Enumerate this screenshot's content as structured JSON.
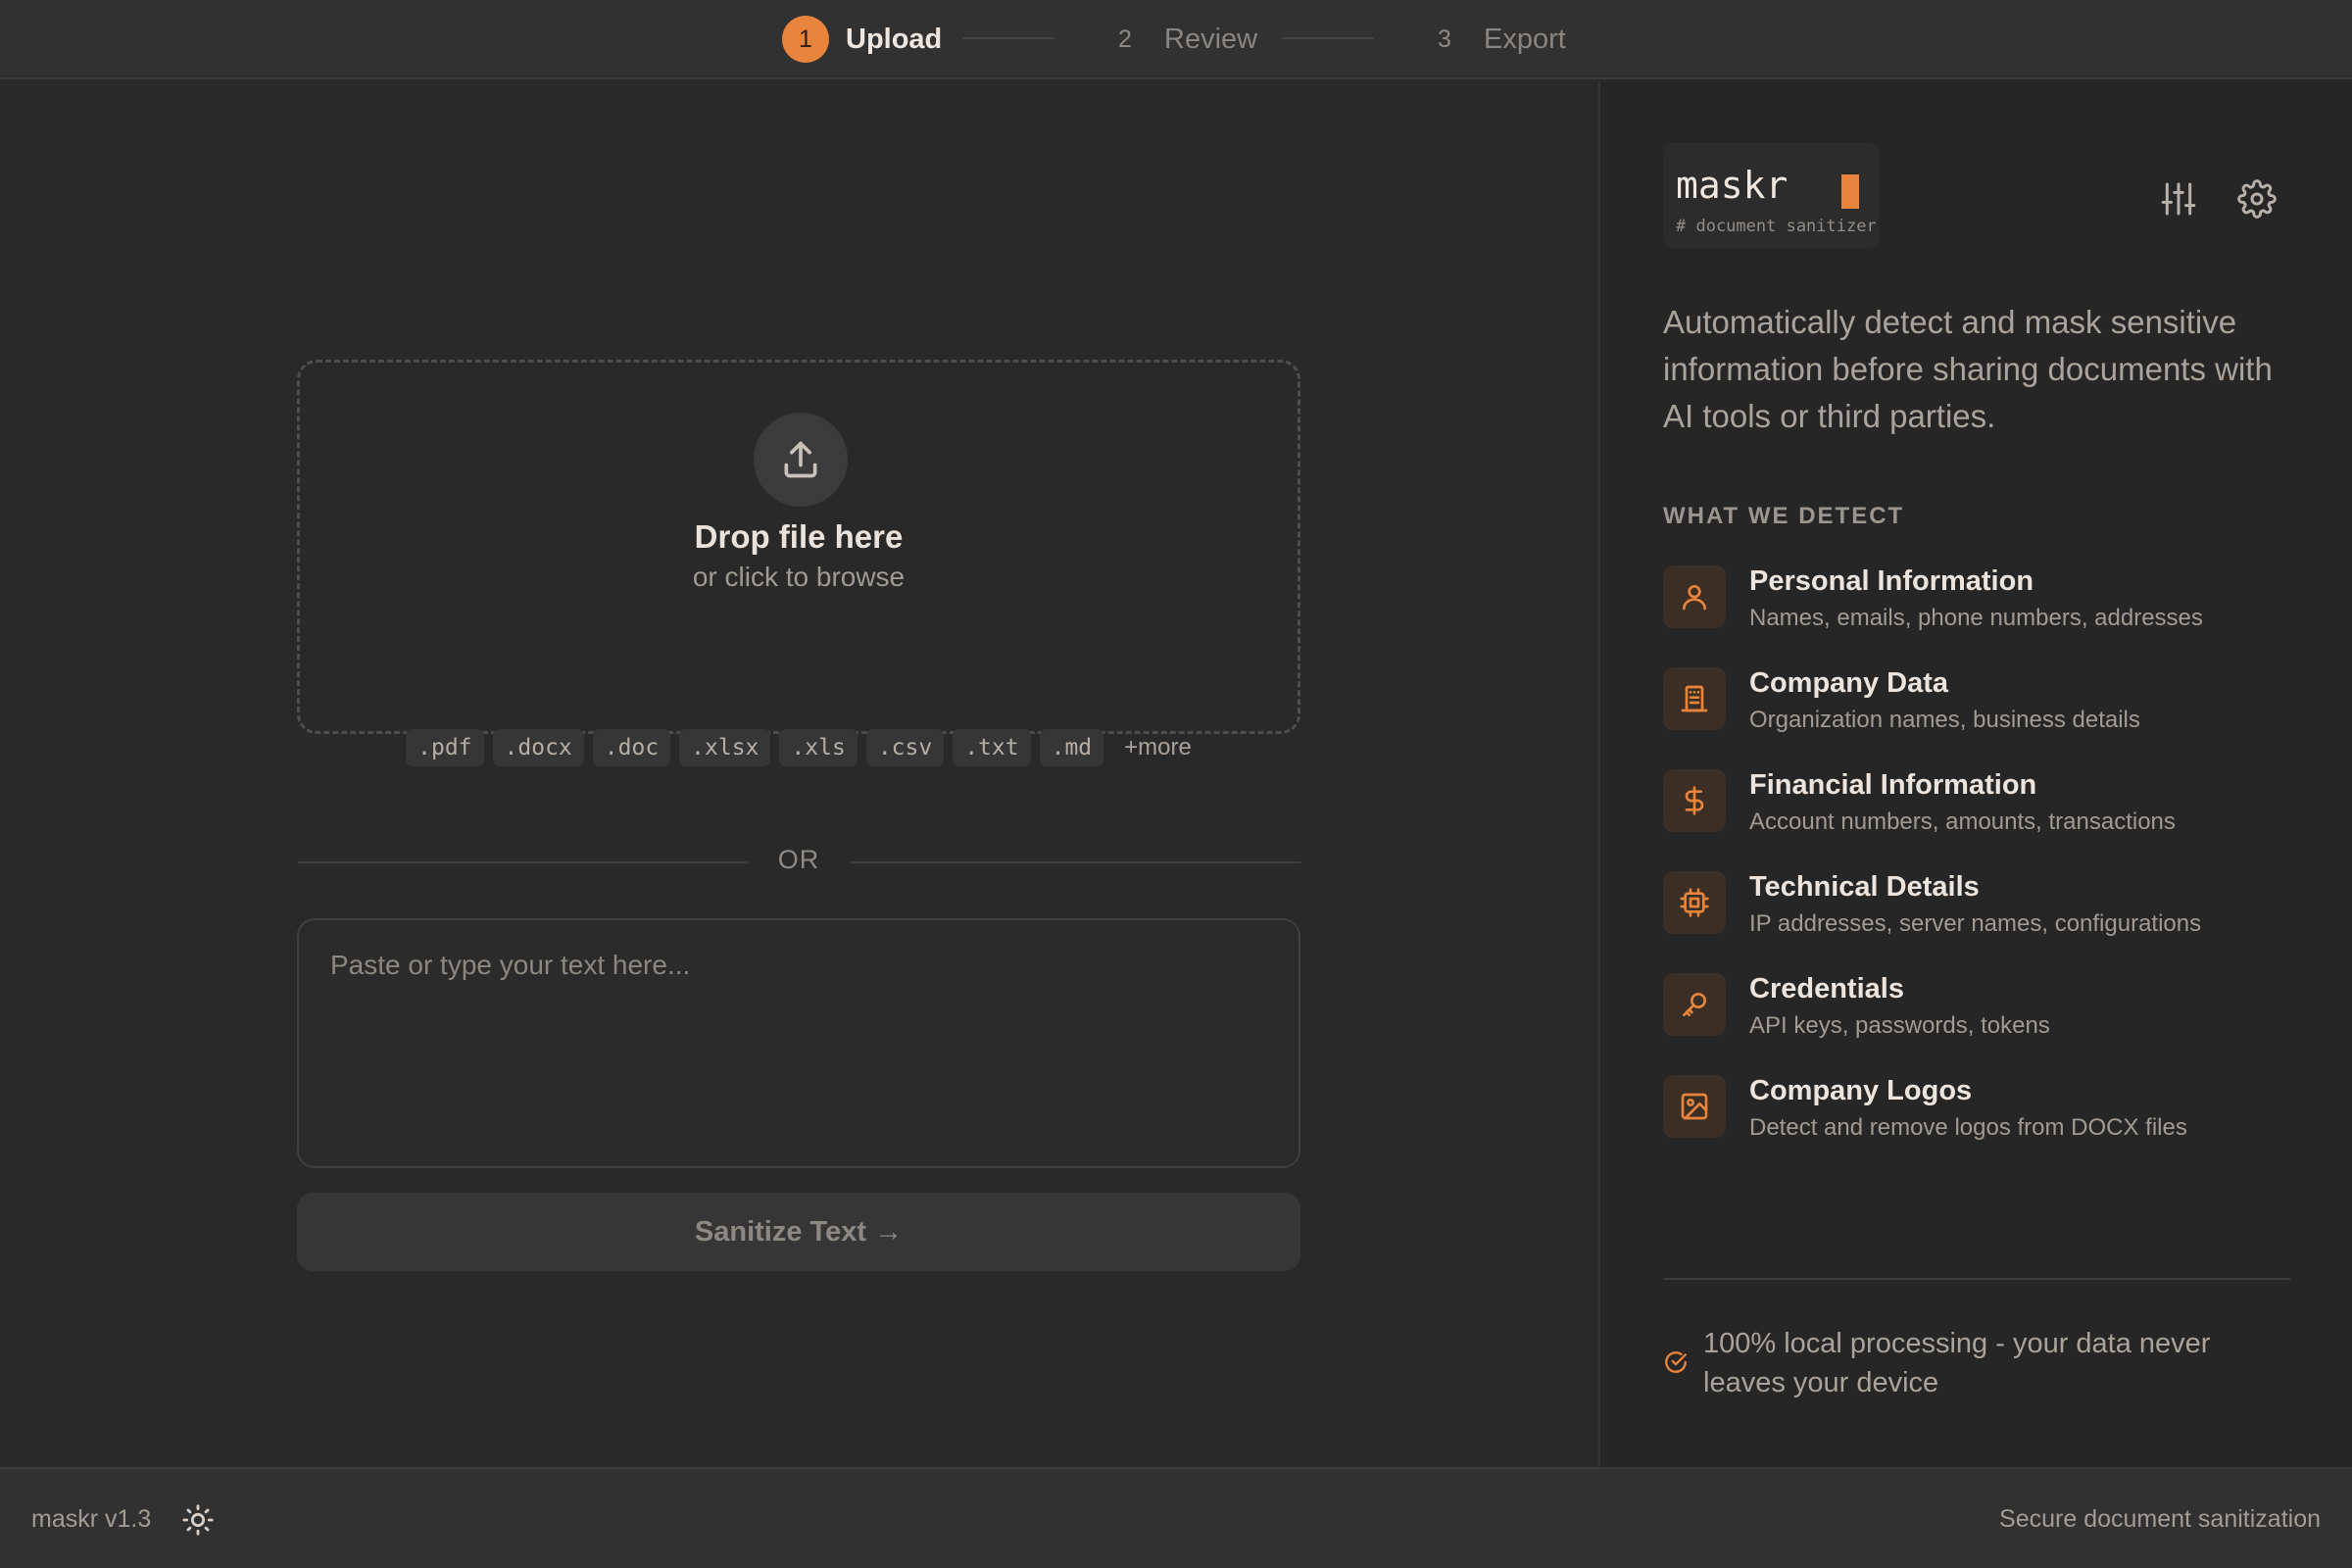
{
  "stepper": {
    "steps": [
      {
        "number": "1",
        "label": "Upload",
        "active": true
      },
      {
        "number": "2",
        "label": "Review",
        "active": false
      },
      {
        "number": "3",
        "label": "Export",
        "active": false
      }
    ]
  },
  "upload": {
    "icon": "upload-icon",
    "title": "Drop file here",
    "subtitle": "or click to browse",
    "extensions": [
      ".pdf",
      ".docx",
      ".doc",
      ".xlsx",
      ".xls",
      ".csv",
      ".txt",
      ".md"
    ],
    "more_label": "+more"
  },
  "divider": {
    "label": "OR"
  },
  "text_input": {
    "placeholder": "Paste or type your text here...",
    "value": ""
  },
  "sanitize_button": {
    "label": "Sanitize Text →"
  },
  "sidebar": {
    "logo": {
      "word": "maskr",
      "tagline": "# document sanitizer"
    },
    "intro": "Automatically detect and mask sensitive information before sharing documents with AI tools or third parties.",
    "section_title": "WHAT WE DETECT",
    "features": [
      {
        "icon": "user-icon",
        "title": "Personal Information",
        "desc": "Names, emails, phone numbers, addresses"
      },
      {
        "icon": "building-icon",
        "title": "Company Data",
        "desc": "Organization names, business details"
      },
      {
        "icon": "dollar-icon",
        "title": "Financial Information",
        "desc": "Account numbers, amounts, transactions"
      },
      {
        "icon": "chip-icon",
        "title": "Technical Details",
        "desc": "IP addresses, server names, configurations"
      },
      {
        "icon": "key-icon",
        "title": "Credentials",
        "desc": "API keys, passwords, tokens"
      },
      {
        "icon": "image-icon",
        "title": "Company Logos",
        "desc": "Detect and remove logos from DOCX files"
      }
    ],
    "local_note": "100% local processing - your data never leaves your device"
  },
  "footer": {
    "version": "maskr v1.3",
    "tagline": "Secure document sanitization"
  },
  "colors": {
    "accent": "#e8843b",
    "background": "#2a2a2a",
    "sidebar": "#262626"
  }
}
